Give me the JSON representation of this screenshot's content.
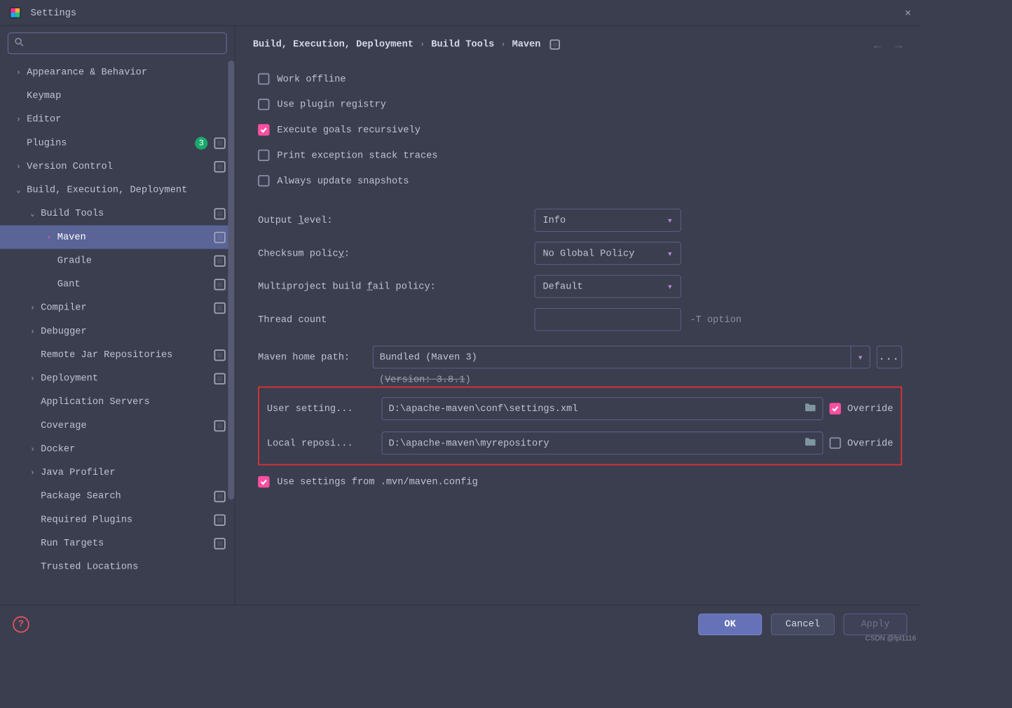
{
  "window": {
    "title": "Settings"
  },
  "search": {
    "placeholder": ""
  },
  "sidebar": {
    "items": [
      {
        "label": "Appearance & Behavior",
        "indent": 0,
        "chev": ">",
        "badge": null,
        "box": false
      },
      {
        "label": "Keymap",
        "indent": 0,
        "chev": "",
        "badge": null,
        "box": false
      },
      {
        "label": "Editor",
        "indent": 0,
        "chev": ">",
        "badge": null,
        "box": false
      },
      {
        "label": "Plugins",
        "indent": 0,
        "chev": "",
        "badge": "3",
        "box": true
      },
      {
        "label": "Version Control",
        "indent": 0,
        "chev": ">",
        "badge": null,
        "box": true
      },
      {
        "label": "Build, Execution, Deployment",
        "indent": 0,
        "chev": "v",
        "badge": null,
        "box": false
      },
      {
        "label": "Build Tools",
        "indent": 1,
        "chev": "v",
        "badge": null,
        "box": true
      },
      {
        "label": "Maven",
        "indent": 2,
        "chev": ">",
        "badge": null,
        "box": true,
        "selected": true
      },
      {
        "label": "Gradle",
        "indent": 2,
        "chev": "",
        "badge": null,
        "box": true
      },
      {
        "label": "Gant",
        "indent": 2,
        "chev": "",
        "badge": null,
        "box": true
      },
      {
        "label": "Compiler",
        "indent": 1,
        "chev": ">",
        "badge": null,
        "box": true
      },
      {
        "label": "Debugger",
        "indent": 1,
        "chev": ">",
        "badge": null,
        "box": false
      },
      {
        "label": "Remote Jar Repositories",
        "indent": 1,
        "chev": "",
        "badge": null,
        "box": true
      },
      {
        "label": "Deployment",
        "indent": 1,
        "chev": ">",
        "badge": null,
        "box": true
      },
      {
        "label": "Application Servers",
        "indent": 1,
        "chev": "",
        "badge": null,
        "box": false
      },
      {
        "label": "Coverage",
        "indent": 1,
        "chev": "",
        "badge": null,
        "box": true
      },
      {
        "label": "Docker",
        "indent": 1,
        "chev": ">",
        "badge": null,
        "box": false
      },
      {
        "label": "Java Profiler",
        "indent": 1,
        "chev": ">",
        "badge": null,
        "box": false
      },
      {
        "label": "Package Search",
        "indent": 1,
        "chev": "",
        "badge": null,
        "box": true
      },
      {
        "label": "Required Plugins",
        "indent": 1,
        "chev": "",
        "badge": null,
        "box": true
      },
      {
        "label": "Run Targets",
        "indent": 1,
        "chev": "",
        "badge": null,
        "box": true
      },
      {
        "label": "Trusted Locations",
        "indent": 1,
        "chev": "",
        "badge": null,
        "box": false
      }
    ]
  },
  "breadcrumb": {
    "parts": [
      "Build, Execution, Deployment",
      "Build Tools",
      "Maven"
    ]
  },
  "checks": {
    "work_offline": {
      "label": "Work offline",
      "checked": false
    },
    "use_plugin_registry": {
      "label": "Use plugin registry",
      "checked": false
    },
    "execute_recursive": {
      "label": "Execute goals recursively",
      "checked": true
    },
    "print_stack": {
      "label": "Print exception stack traces",
      "checked": false
    },
    "update_snapshots": {
      "label": "Always update snapshots",
      "checked": false
    },
    "use_mvn_config": {
      "label": "Use settings from .mvn/maven.config",
      "checked": true
    }
  },
  "fields": {
    "output_level": {
      "label_pre": "Output ",
      "label_ul": "l",
      "label_post": "evel:",
      "value": "Info"
    },
    "checksum_policy": {
      "label_pre": "Checksum polic",
      "label_ul": "y",
      "label_post": ":",
      "value": "No Global Policy"
    },
    "fail_policy": {
      "label_pre": "Multiproject build ",
      "label_ul": "f",
      "label_post": "ail policy:",
      "value": "Default"
    },
    "thread_count": {
      "label": "Thread count",
      "value": "",
      "hint": "-T option"
    },
    "maven_home": {
      "label_pre": "Maven ",
      "label_ul": "h",
      "label_post": "ome path:",
      "value": "Bundled (Maven 3)"
    },
    "version": "(Version: 3.8.1)",
    "user_settings": {
      "label_pre": "User ",
      "label_ul": "s",
      "label_post": "etting...",
      "value": "D:\\apache-maven\\conf\\settings.xml",
      "override_label": "Override",
      "override_checked": true
    },
    "local_repo": {
      "label_pre": "Local ",
      "label_ul": "r",
      "label_post": "eposi...",
      "value": "D:\\apache-maven\\myrepository",
      "override_label": "Override",
      "override_checked": false
    }
  },
  "footer": {
    "ok": "OK",
    "cancel": "Cancel",
    "apply": "Apply"
  },
  "watermark": "CSDN @fpl1116"
}
